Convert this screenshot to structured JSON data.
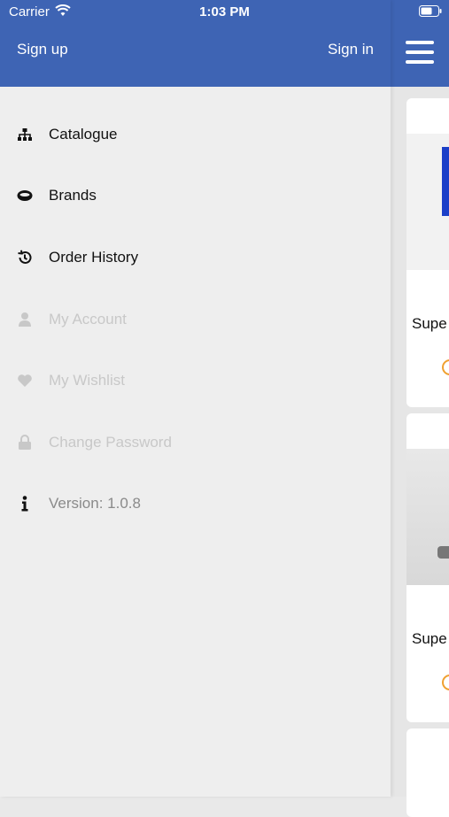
{
  "status_bar": {
    "carrier": "Carrier",
    "time": "1:03 PM"
  },
  "header": {
    "signup_label": "Sign up",
    "signin_label": "Sign in",
    "menu_icon": "hamburger-icon"
  },
  "menu": [
    {
      "label": "Catalogue",
      "icon": "sitemap-icon",
      "enabled": true
    },
    {
      "label": "Brands",
      "icon": "ring-icon",
      "enabled": true
    },
    {
      "label": "Order History",
      "icon": "history-icon",
      "enabled": true
    },
    {
      "label": "My Account",
      "icon": "user-icon",
      "enabled": false
    },
    {
      "label": "My Wishlist",
      "icon": "heart-icon",
      "enabled": false
    },
    {
      "label": "Change Password",
      "icon": "lock-icon",
      "enabled": false
    },
    {
      "label": "Version: 1.0.8",
      "icon": "info-icon",
      "enabled": false
    }
  ],
  "products": [
    {
      "title_fragment": "Supe"
    },
    {
      "title_fragment": "Supe"
    }
  ],
  "colors": {
    "brand": "#3e64b4",
    "drawer_bg": "#eeeeee",
    "accent": "#f0a030"
  }
}
